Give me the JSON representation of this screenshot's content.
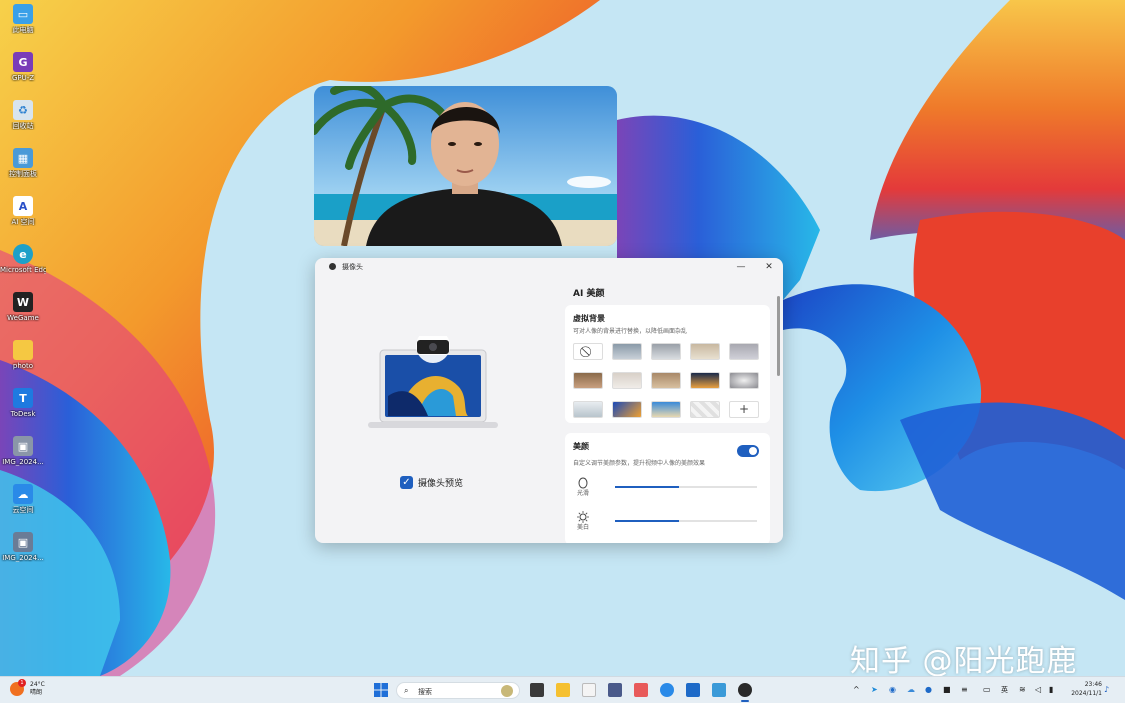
{
  "desktop": {
    "icons": [
      {
        "label": "此电脑",
        "icon": "monitor-icon"
      },
      {
        "label": "GPU-Z",
        "icon": "gpuz-icon"
      },
      {
        "label": "回收站",
        "icon": "recycle-bin-icon"
      },
      {
        "label": "控制面板",
        "icon": "control-panel-icon"
      },
      {
        "label": "AI 空间",
        "icon": "ai-space-icon"
      },
      {
        "label": "Microsoft Edge",
        "icon": "edge-icon"
      },
      {
        "label": "WeGame",
        "icon": "wegame-icon"
      },
      {
        "label": "photo",
        "icon": "folder-icon"
      },
      {
        "label": "ToDesk",
        "icon": "todesk-icon"
      },
      {
        "label": "IMG_2024...",
        "icon": "image-file-icon"
      },
      {
        "label": "云空间",
        "icon": "cloud-space-icon"
      },
      {
        "label": "IMG_2024...",
        "icon": "image-file-icon"
      }
    ]
  },
  "dialog": {
    "title": "摄像头",
    "minimize": "—",
    "close": "✕",
    "preview_checkbox_label": "摄像头预览",
    "preview_checked": true,
    "ai_section_title": "AI 美颜",
    "virtual_bg": {
      "title": "虚拟背景",
      "description": "可对人像的背景进行替换，以降低画面杂乱",
      "thumbs": [
        "none",
        "office-1",
        "office-2",
        "room-1",
        "hall-1",
        "room-2",
        "room-3",
        "room-4",
        "night-1",
        "blur-1",
        "snow-1",
        "wave-1",
        "beach-1",
        "transparent",
        "add"
      ],
      "add_label": "+"
    },
    "beauty": {
      "title": "美颜",
      "description": "自定义调节美颜参数，提升视频中人像的美颜效果",
      "enabled": true,
      "sliders": [
        {
          "label": "光滑",
          "icon": "smooth-icon",
          "value": 0.45
        },
        {
          "label": "美白",
          "icon": "brightness-icon",
          "value": 0.45
        }
      ]
    }
  },
  "watermark": "知乎 @阳光跑鹿",
  "taskbar": {
    "weather_temp": "24°C",
    "weather_desc": "晴朗",
    "weather_badge": "1",
    "search_placeholder": "搜索",
    "tray_lang": "英",
    "tray_chevron": "^",
    "time": "23:46",
    "date": "2024/11/1"
  },
  "colors": {
    "accent": "#1f5fbf",
    "sky": "#bfe3f3"
  }
}
